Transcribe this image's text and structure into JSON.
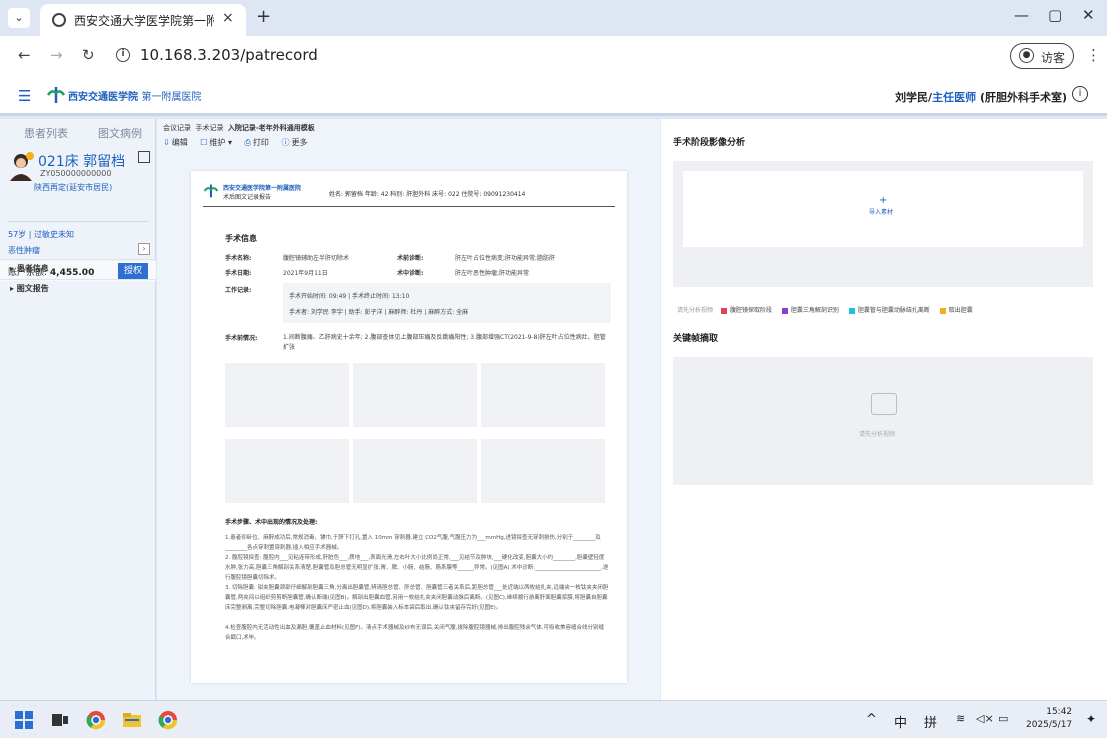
{
  "browser": {
    "tab_title": "西安交通大学医学院第一附属医",
    "tab_close": "×",
    "new_tab": "+",
    "url": "10.168.3.203/patrecord",
    "guest_label": "访客",
    "minimize": "—",
    "restore": "▢",
    "close": "✕"
  },
  "header": {
    "logo_main": "西安交通医学院",
    "logo_sub": "第一附属医院",
    "user_name": "刘学民/",
    "user_role": "主任医师",
    "user_dept": "(肝胆外科手术室)"
  },
  "sidebar": {
    "tabs": [
      "患者列表",
      "图文病例"
    ],
    "bed_name": "021床 郭留档",
    "patient_id": "ZY050000000000",
    "residence": "陕西再定(延安市居民)",
    "age_line": "57岁 | 过敏史未知",
    "tumor": "恶性肿瘤",
    "balance_label": "账户余额:",
    "balance_value": "4,455.00",
    "grant_label": "授权",
    "sections": [
      "▸ 患者信息",
      "▸ 图文报告"
    ]
  },
  "middle": {
    "crumbs": [
      "会议记录",
      "手术记录",
      "入院记录-老年外科通用模板"
    ],
    "toolbar": [
      {
        "icon": "⇩",
        "label": "编辑"
      },
      {
        "icon": "☐",
        "label": "维护 ▾"
      },
      {
        "icon": "⎙",
        "label": "打印"
      },
      {
        "icon": "ⓘ",
        "label": "更多"
      }
    ],
    "paper": {
      "org": "西安交通医学院第一附属医院",
      "report_name": "术后图文记录报告",
      "meta": "姓名: 郭留档    年龄: 42    科别: 肝胆外科    床号: 022    住院号: 09091230414",
      "section_title": "手术信息",
      "rows": [
        {
          "label": "手术名称:",
          "value": "腹腔镜辅助左半肝切除术",
          "label2": "术前诊断:",
          "value2": "肝左叶占位性病变;肝功能异常;脂肪肝"
        },
        {
          "label": "手术日期:",
          "value": "2021年9月11日",
          "label2": "术中诊断:",
          "value2": "肝左叶恶性肿瘤;肝功能异常"
        }
      ],
      "work_label": "工作记录:",
      "work_line1": "手术开始时间: 09:49   |   手术终止时间: 13:10",
      "work_line2": "手术者: 刘学民 李宇   |   助手: 彭子洋   |   麻醉师: 杜丹   |   麻醉方式: 全麻",
      "pre_label": "手术前情况:",
      "pre_text": "1.间断腹痛、乙肝病史十余年; 2.腹部查体见上腹部压痛及反跳痛阳性; 3.腹部增强CT(2021-9-8)肝左叶占位性病灶、胆管扩张",
      "steps_title": "手术步骤、术中出现的情况及处理:",
      "steps": [
        "1.患者仰卧位、麻醉成功后,常规消毒、铺巾,于脐下打孔,置入 10mm 穿刺器,建立 CO2气腹,气腹压力为___mmHg,进镜探查无穿刺损伤,分别于________及________各点穿刺置穿刺器,插入相应手术器械。",
        "2. 腹腔镜探查: 腹腔内___见粘连带形成,肝脏色___,质地___,表面光滑,左右叶大小比例尚正常,___见结节及肿块,___硬化改变,胆囊大小约________,胆囊壁轻度水肿,张力高,胆囊三角解剖关系清楚,胆囊管及胆总管无明显扩张,胃、脾、小肠、结肠、肠系膜等______异常。(见图A) 术中诊断:________________________,遂行腹腔镜胆囊切除术。",
        "3. 切除胆囊: 钳夹胆囊颈部仔细解剖胆囊三角,分离出胆囊管,辨清胆总管、肝总管、胆囊管三者关系后,距胆总管___处近端以两枚结扎夹,远端夹一枚钛夹夹闭胆囊管,两夹间以组织剪剪断胆囊管,确认断端(见图B)。解剖出胆囊血管,另用一枚结扎夹夹闭胆囊动脉后离断。(见图C),继续顺行游离肝面胆囊浆膜,将胆囊自胆囊床完整剥离,完整切除胆囊,电凝棒对胆囊床严密止血(见图D),将胆囊装入标本袋后取出,确认钛夹留存完好(见图E)。",
        "4.检查腹腔内无活动性出血及漏胆,覆盖止血材料(见图F)。清点手术器械及纱布无误后,关闭气腹,拔除腹腔镜器械,排出腹腔残余气体,可吸收美容缝合线分别缝合戳口,术毕。"
      ]
    }
  },
  "right": {
    "title1": "手术阶段影像分析",
    "import_plus": "+",
    "import_label": "导入素材",
    "legend_hint": "请先分析视频",
    "legend": [
      {
        "label": "腹腔镜探取阶段",
        "color": "#e0405a"
      },
      {
        "label": "胆囊三角解剖识别",
        "color": "#8a3fd1"
      },
      {
        "label": "胆囊管与胆囊动脉结扎离断",
        "color": "#1ec3d8"
      },
      {
        "label": "取出胆囊",
        "color": "#f2b01e"
      }
    ],
    "title2": "关键帧摘取",
    "empty_label": "请先分析视频"
  },
  "taskbar": {
    "tray_chevron": "^",
    "ime1": "中",
    "ime2": "拼",
    "time": "15:42",
    "date": "2025/5/17"
  }
}
